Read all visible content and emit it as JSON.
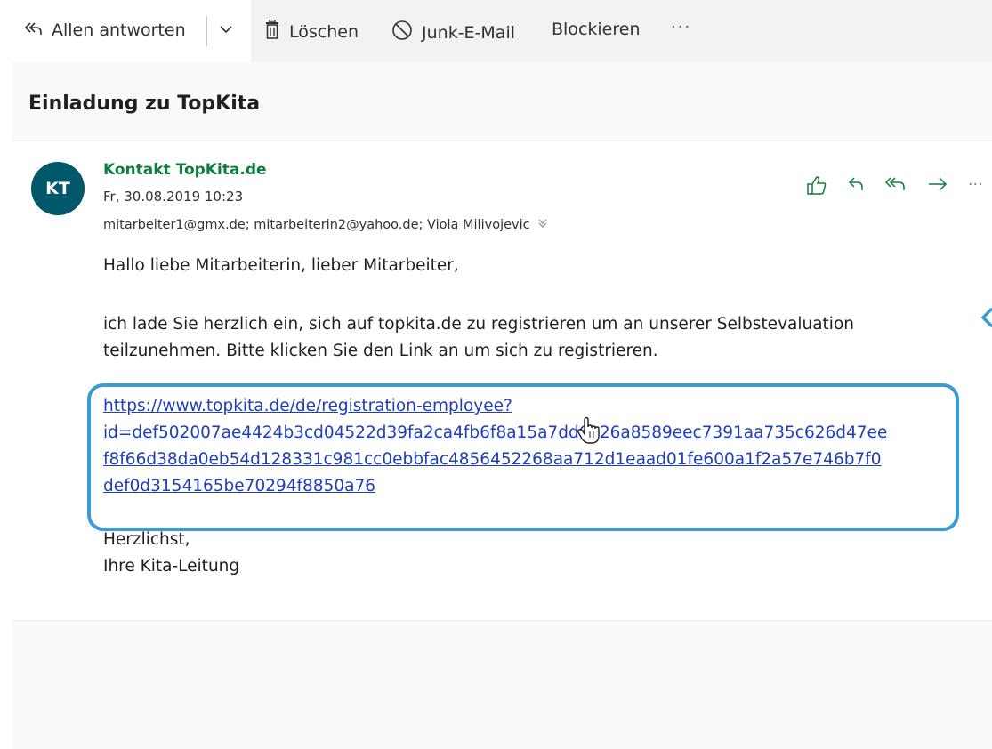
{
  "toolbar": {
    "reply_all_label": "Allen antworten",
    "delete_label": "Löschen",
    "junk_label": "Junk-E-Mail",
    "block_label": "Blockieren",
    "more_label": "···"
  },
  "message": {
    "subject": "Einladung zu TopKita",
    "avatar_initials": "KT",
    "sender": "Kontakt TopKita.de",
    "date": "Fr, 30.08.2019 10:23",
    "recipients": "mitarbeiter1@gmx.de; mitarbeiterin2@yahoo.de; Viola Milivojevic",
    "greeting": "Hallo liebe Mitarbeiterin, lieber Mitarbeiter,",
    "paragraph": "ich lade Sie herzlich ein, sich auf topkita.de zu registrieren um an unserer Selbstevaluation teilzunehmen. Bitte klicken Sie den Link an um sich zu registrieren.",
    "link_lines": [
      "https://www.topkita.de/de/registration-employee?",
      "id=def502007ae4424b3cd04522d39fa2ca4fb6f8a15a7dd6e26a8589eec7391aa735c626d47ee",
      "f8f66d38da0eb54d128331c981cc0ebbfac4856452268aa712d1eaad01fe600a1f2a57e746b7f0",
      "def0d3154165be70294f8850a76"
    ],
    "closing_line1": "Herzlichst,",
    "closing_line2": "Ihre Kita-Leitung"
  },
  "colors": {
    "accent_green": "#107c41",
    "avatar_bg": "#00586a",
    "link_blue": "#1f3fb5",
    "highlight_border": "#3c9ad5"
  },
  "icons": {
    "reply_all": "reply-all-icon",
    "delete": "trash-icon",
    "junk": "block-circle-icon",
    "like": "thumbs-up-icon",
    "reply": "reply-icon",
    "forward": "forward-icon"
  }
}
